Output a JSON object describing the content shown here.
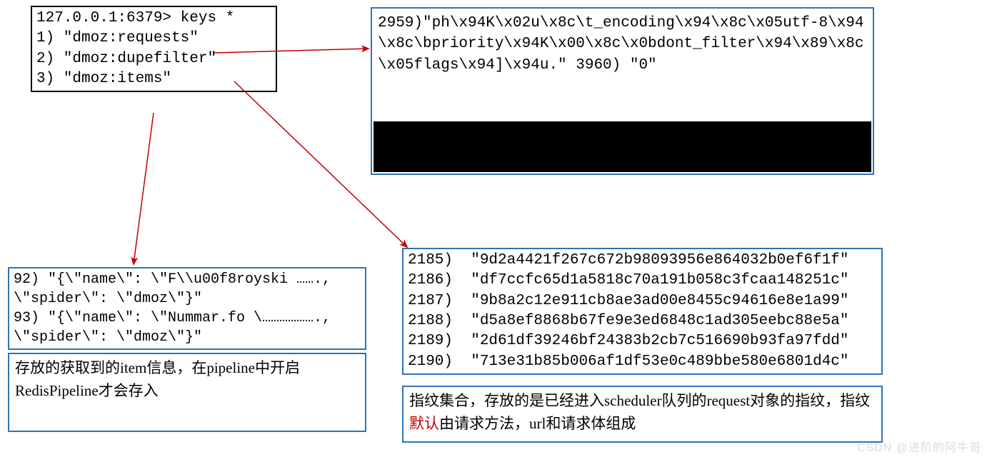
{
  "keysBox": {
    "l1": "127.0.0.1:6379> keys *",
    "l2": "1) \"dmoz:requests\"",
    "l3": "2) \"dmoz:dupefilter\"",
    "l4": "3) \"dmoz:items\""
  },
  "requestsBox": {
    "text": "2959)\"ph\\x94K\\x02u\\x8c\\t_encoding\\x94\\x8c\\x05utf-8\\x94\\x8c\\bpriority\\x94K\\x00\\x8c\\x0bdont_filter\\x94\\x89\\x8c\\x05flags\\x94]\\x94u.\"\n3960) \"0\""
  },
  "itemsBox": {
    "l1": "92) \"{\\\"name\\\": \\\"F\\\\u00f8royski …….,",
    "l2": "\\\"spider\\\": \\\"dmoz\\\"}\"",
    "l3": "93) \"{\\\"name\\\": \\\"Nummar.fo \\……………….,",
    "l4": "\\\"spider\\\": \\\"dmoz\\\"}\""
  },
  "itemsDesc": {
    "pre": "存放的获取到的item信息，在pipeline中开启RedisPipeline才会存入"
  },
  "dupeBox": {
    "l1": "2185)  \"9d2a4421f267c672b98093956e864032b0ef6f1f\"",
    "l2": "2186)  \"df7ccfc65d1a5818c70a191b058c3fcaa148251c\"",
    "l3": "2187)  \"9b8a2c12e911cb8ae3ad00e8455c94616e8e1a99\"",
    "l4": "2188)  \"d5a8ef8868b67fe9e3ed6848c1ad305eebc88e5a\"",
    "l5": "2189)  \"2d61df39246bf24383b2cb7c516690b93fa97fdd\"",
    "l6": "2190)  \"713e31b85b006af1df53e0c489bbe580e6801d4c\""
  },
  "dupeDesc": {
    "pre": "指纹集合，存放的是已经进入scheduler队列的request对象的指纹，指纹",
    "hl": "默认",
    "post": "由请求方法，url和请求体组成"
  },
  "watermark": "CSDN @进阶的阿牛哥"
}
